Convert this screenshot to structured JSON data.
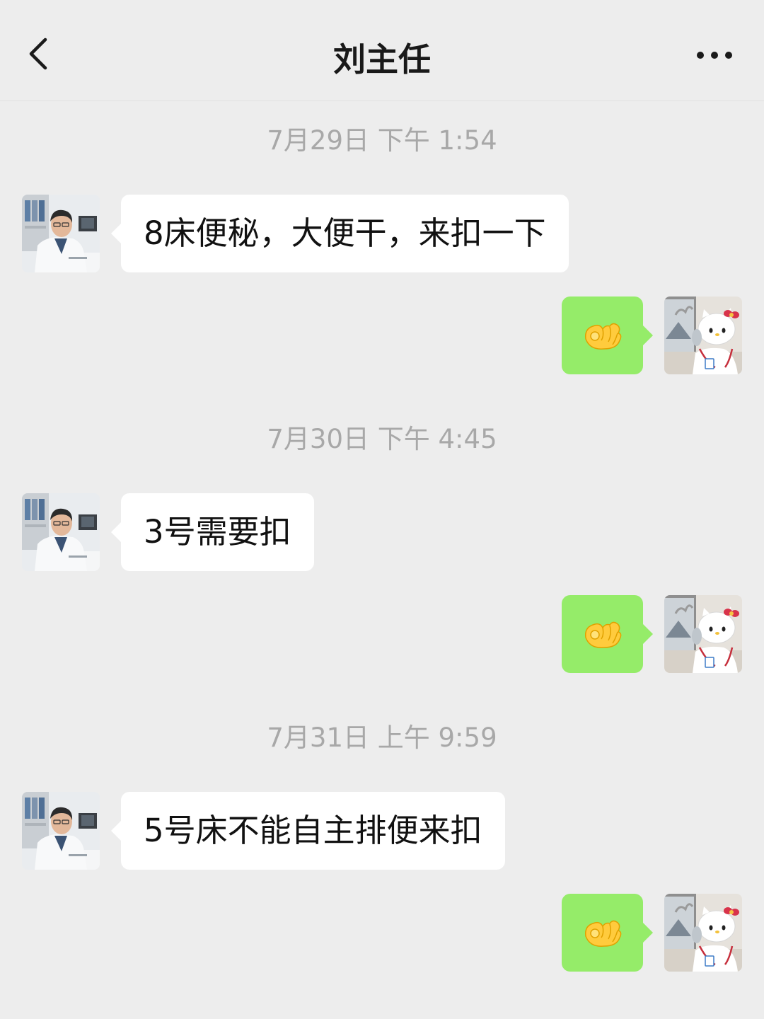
{
  "header": {
    "title": "刘主任",
    "back_icon": "chevron-left-icon",
    "more_icon": "more-dots-icon"
  },
  "messages": [
    {
      "timestamp": "7月29日 下午 1:54",
      "incoming": "8床便秘，大便干，来扣一下",
      "reply_icon": "ok-hand-emoji"
    },
    {
      "timestamp": "7月30日 下午 4:45",
      "incoming": "3号需要扣",
      "reply_icon": "ok-hand-emoji"
    },
    {
      "timestamp": "7月31日 上午 9:59",
      "incoming": "5号床不能自主排便来扣",
      "reply_icon": "ok-hand-emoji"
    }
  ],
  "colors": {
    "background": "#ededed",
    "incoming_bubble": "#ffffff",
    "outgoing_bubble": "#95ec69",
    "timestamp_text": "#a8a8a8"
  }
}
